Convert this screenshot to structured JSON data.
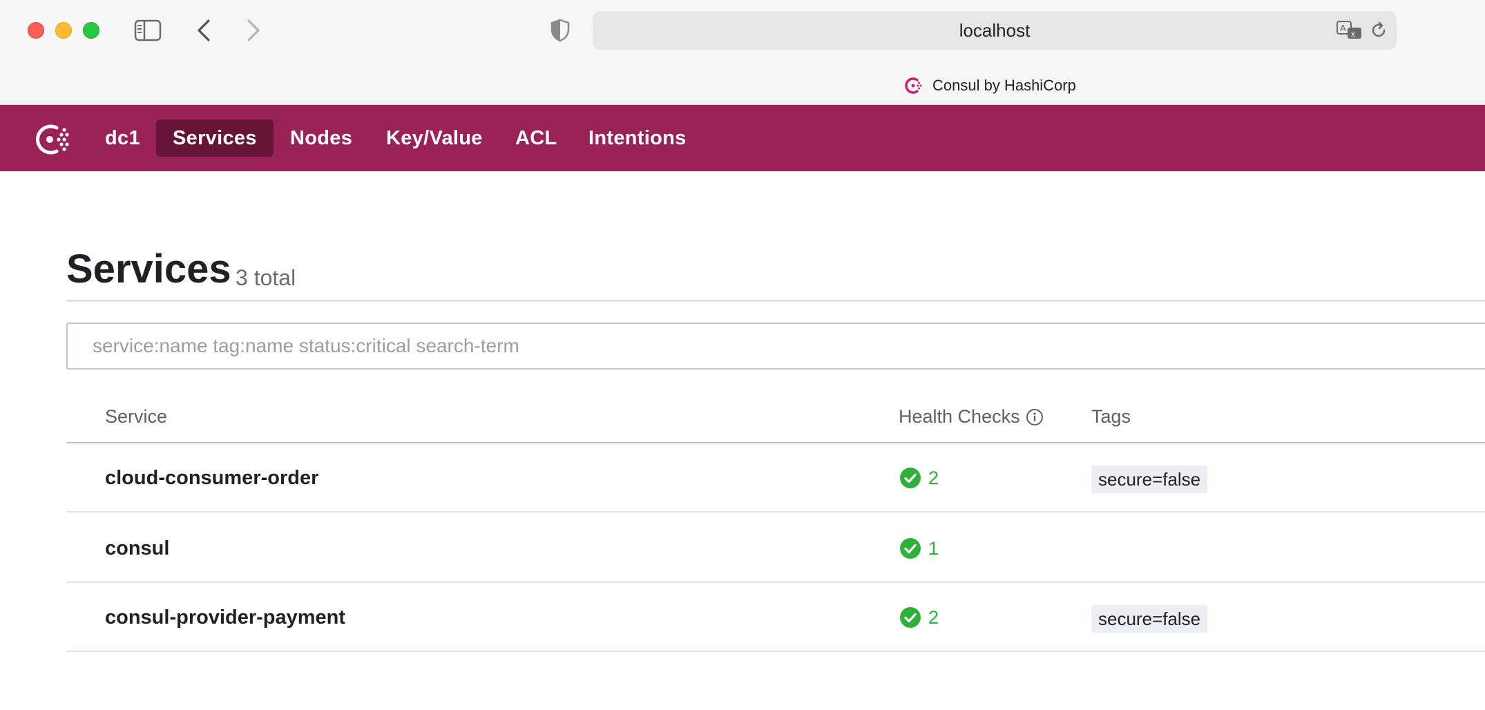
{
  "browser": {
    "url": "localhost",
    "tab_title": "Consul by HashiCorp"
  },
  "nav": {
    "datacenter": "dc1",
    "items": [
      "Services",
      "Nodes",
      "Key/Value",
      "ACL",
      "Intentions"
    ],
    "active": "Services",
    "brand_color": "#9b2257",
    "active_color": "#661537"
  },
  "page": {
    "title": "Services",
    "count": "3 total",
    "search_placeholder": "service:name tag:name status:critical search-term"
  },
  "table": {
    "columns": [
      "Service",
      "Health Checks",
      "Tags"
    ],
    "rows": [
      {
        "name": "cloud-consumer-order",
        "checks": "2",
        "tag": "secure=false"
      },
      {
        "name": "consul",
        "checks": "1",
        "tag": ""
      },
      {
        "name": "consul-provider-payment",
        "checks": "2",
        "tag": "secure=false"
      }
    ]
  },
  "icons": {
    "health_passing": "check-circle-icon",
    "info": "info-icon"
  },
  "colors": {
    "passing": "#2eb039"
  }
}
